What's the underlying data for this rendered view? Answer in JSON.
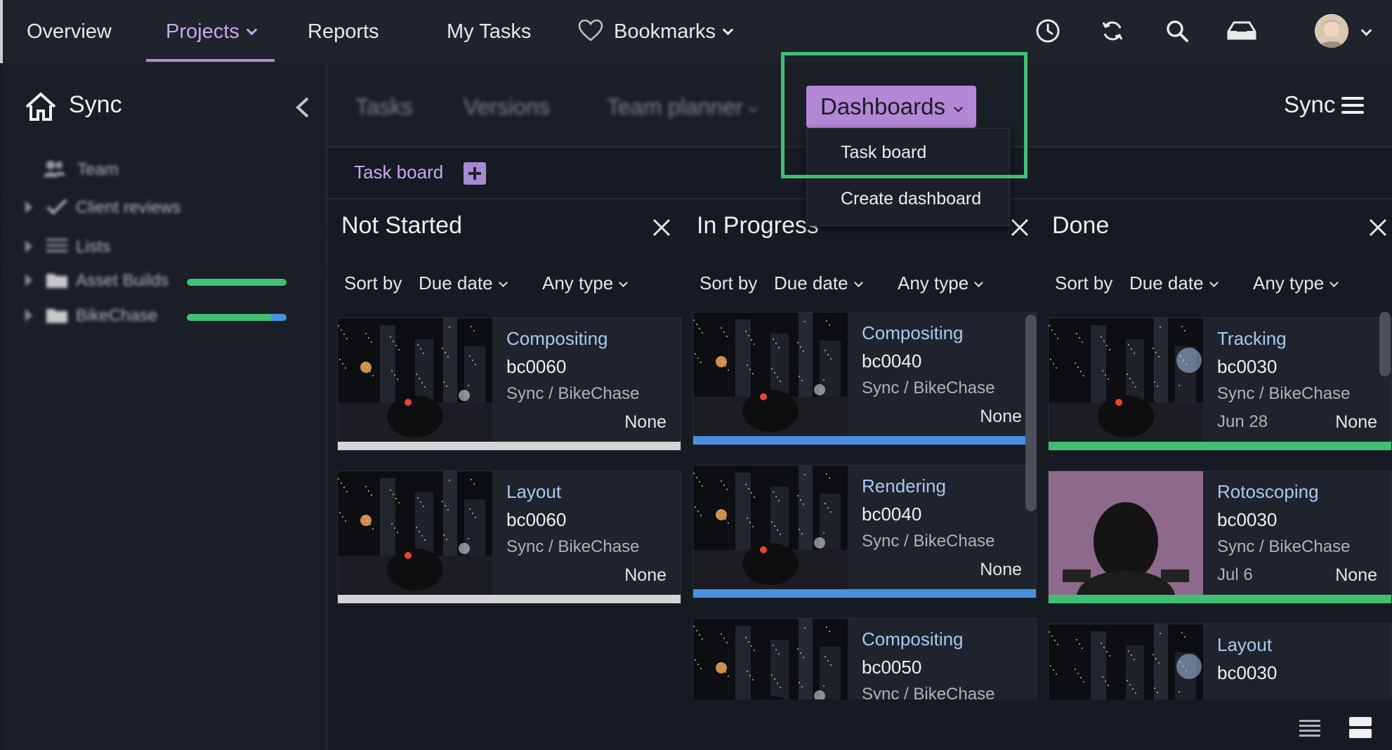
{
  "nav": {
    "items": [
      {
        "label": "Overview"
      },
      {
        "label": "Projects"
      },
      {
        "label": "Reports"
      },
      {
        "label": "My Tasks"
      },
      {
        "label": "Bookmarks"
      }
    ]
  },
  "sidebar": {
    "title": "Sync",
    "items": [
      {
        "label": "Team"
      },
      {
        "label": "Client reviews"
      },
      {
        "label": "Lists"
      },
      {
        "label": "Asset Builds",
        "progress": 1.0,
        "color": "#3fbf73"
      },
      {
        "label": "BikeChase",
        "progress": 0.85,
        "color": "#3fbf73",
        "tail_color": "#4a90e2"
      }
    ]
  },
  "subheader": {
    "tabs": [
      {
        "label": "Tasks"
      },
      {
        "label": "Versions"
      },
      {
        "label": "Team planner"
      }
    ],
    "dashboards_label": "Dashboards",
    "project_label": "Sync"
  },
  "dashboard_tabs": {
    "active": "Task board"
  },
  "dashboards_menu": {
    "items": [
      {
        "label": "Task board"
      },
      {
        "label": "Create dashboard"
      }
    ]
  },
  "sort": {
    "label": "Sort by",
    "field": "Due date",
    "type": "Any type"
  },
  "columns": [
    {
      "title": "Not Started",
      "cards": [
        {
          "type": "Compositing",
          "code": "bc0060",
          "path": "Sync / BikeChase",
          "date": "",
          "assignee": "None",
          "status_color": "#d4d4d4"
        },
        {
          "type": "Layout",
          "code": "bc0060",
          "path": "Sync / BikeChase",
          "date": "",
          "assignee": "None",
          "status_color": "#d4d4d4"
        }
      ]
    },
    {
      "title": "In Progress",
      "cards": [
        {
          "type": "Compositing",
          "code": "bc0040",
          "path": "Sync / BikeChase",
          "date": "",
          "assignee": "None",
          "status_color": "#4a90e2"
        },
        {
          "type": "Rendering",
          "code": "bc0040",
          "path": "Sync / BikeChase",
          "date": "",
          "assignee": "None",
          "status_color": "#4a90e2"
        },
        {
          "type": "Compositing",
          "code": "bc0050",
          "path": "Sync / BikeChase",
          "date": "",
          "assignee": "",
          "status_color": "#4a90e2"
        }
      ]
    },
    {
      "title": "Done",
      "cards": [
        {
          "type": "Tracking",
          "code": "bc0030",
          "path": "Sync / BikeChase",
          "date": "Jun 28",
          "assignee": "None",
          "status_color": "#3fbf73"
        },
        {
          "type": "Rotoscoping",
          "code": "bc0030",
          "path": "Sync / BikeChase",
          "date": "Jul 6",
          "assignee": "None",
          "status_color": "#3fbf73"
        },
        {
          "type": "Layout",
          "code": "bc0030",
          "path": "",
          "date": "",
          "assignee": "",
          "status_color": "#3fbf73"
        }
      ]
    }
  ],
  "colors": {
    "accent": "#b387d6",
    "highlight": "#3fbf73",
    "background": "#161a22"
  }
}
